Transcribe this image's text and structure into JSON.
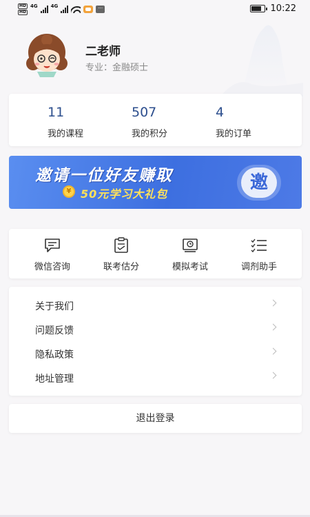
{
  "status_bar": {
    "network_top": "HD",
    "network_bottom": "HD",
    "signal1_label": "4G",
    "signal2_label": "4G",
    "dots": "···",
    "battery_level": 0.8,
    "time": "10:22"
  },
  "profile": {
    "name": "二老师",
    "major": "专业：金融硕士"
  },
  "stats": [
    {
      "value": "11",
      "label": "我的课程"
    },
    {
      "value": "507",
      "label": "我的积分"
    },
    {
      "value": "4",
      "label": "我的订单"
    }
  ],
  "banner": {
    "title": "邀请一位好友赚取",
    "coin": "¥",
    "subtitle": "50元学习大礼包",
    "badge": "邀",
    "colors": {
      "start": "#5a8ef0",
      "end": "#3d6fe0",
      "accent": "#ffe25a"
    }
  },
  "tools": [
    {
      "label": "微信咨询",
      "icon": "chat-icon"
    },
    {
      "label": "联考估分",
      "icon": "clipboard-icon"
    },
    {
      "label": "模拟考试",
      "icon": "certificate-icon"
    },
    {
      "label": "调剂助手",
      "icon": "checklist-icon"
    }
  ],
  "menu": [
    {
      "label": "关于我们"
    },
    {
      "label": "问题反馈"
    },
    {
      "label": "隐私政策"
    },
    {
      "label": "地址管理"
    }
  ],
  "logout": {
    "label": "退出登录"
  },
  "colors": {
    "accent": "#2d4f8e",
    "background": "#f7f6f8"
  }
}
